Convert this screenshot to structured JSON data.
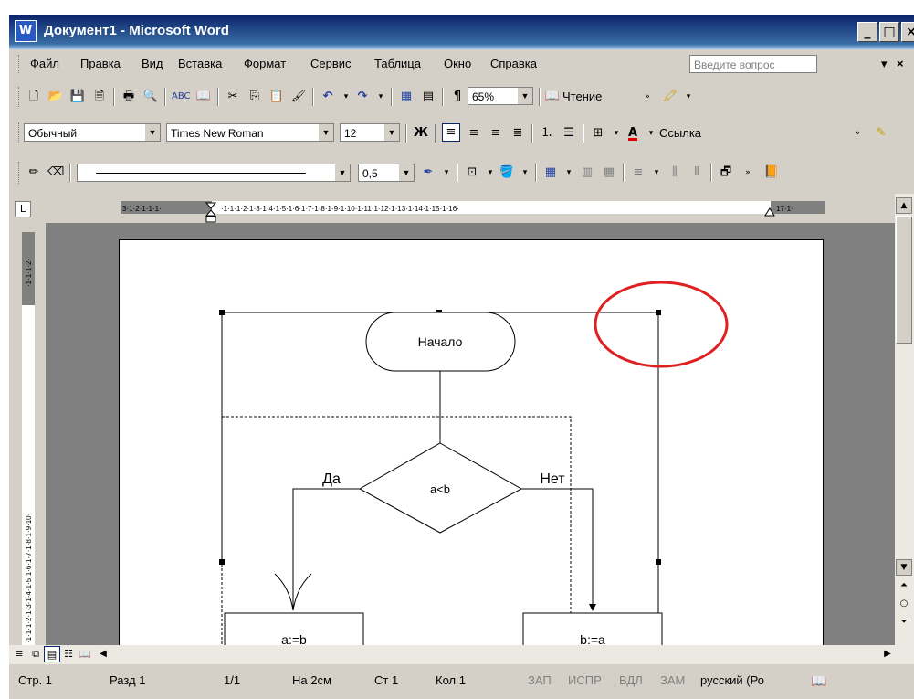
{
  "window": {
    "title": "Документ1 - Microsoft Word"
  },
  "menu": {
    "items": [
      "Файл",
      "Правка",
      "Вид",
      "Вставка",
      "Формат",
      "Сервис",
      "Таблица",
      "Окно",
      "Справка"
    ],
    "ask_placeholder": "Введите вопрос",
    "close_doc": "×"
  },
  "standard_toolbar": {
    "zoom": "65%",
    "reading": "Чтение"
  },
  "formatting_toolbar": {
    "style": "Обычный",
    "font": "Times New Roman",
    "size": "12",
    "bold": "Ж",
    "font_color_glyph": "A",
    "link_label": "Ссылка"
  },
  "drawing_toolbar": {
    "line_weight": "0,5"
  },
  "flowchart": {
    "start_label": "Начало",
    "condition": "a<b",
    "yes_label": "Да",
    "no_label": "Нет",
    "left_action": "a:=b",
    "right_action": "b:=a"
  },
  "statusbar": {
    "page": "Стр. 1",
    "section": "Разд 1",
    "pages": "1/1",
    "at": "На 2см",
    "line": "Ст 1",
    "col": "Кол 1",
    "rec": "ЗАП",
    "trk": "ИСПР",
    "ext": "ВДЛ",
    "ovr": "ЗАМ",
    "language": "русский (Ро"
  },
  "colors": {
    "titlebar": "#0a246a",
    "chrome": "#d4d0c8",
    "annotation_circle": "#e02020"
  }
}
